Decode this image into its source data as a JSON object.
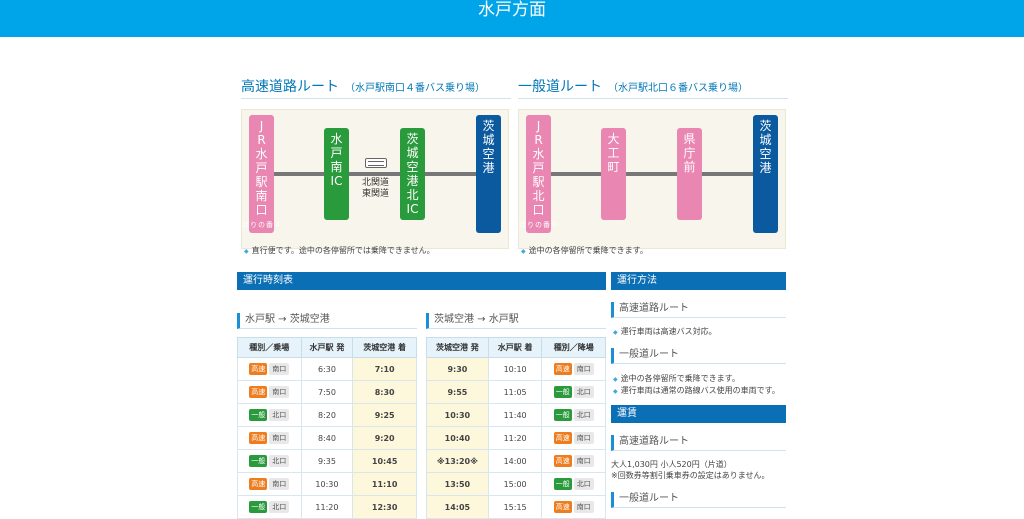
{
  "header": {
    "title": "水戸方面"
  },
  "routes": {
    "expressway": {
      "title": "高速道路ルート",
      "sub": "（水戸駅南口４番バス乗り場）",
      "stops": [
        {
          "lines": [
            "J",
            "R",
            "水",
            "戸",
            "駅",
            "南",
            "口"
          ],
          "tiny": "４番のりば",
          "color": "pink"
        },
        {
          "lines": [
            "水",
            "戸",
            "南",
            "IC"
          ],
          "color": "green"
        },
        {
          "lines": [
            "茨",
            "城",
            "空",
            "港",
            "北",
            "IC"
          ],
          "color": "green"
        },
        {
          "lines": [
            "茨",
            "城",
            "空",
            "港"
          ],
          "color": "navy"
        }
      ],
      "bus_label": "北関道\n東関道",
      "note": "直行便です。途中の各停留所では乗降できません。"
    },
    "general": {
      "title": "一般道ルート",
      "sub": "（水戸駅北口６番バス乗り場）",
      "stops": [
        {
          "lines": [
            "J",
            "R",
            "水",
            "戸",
            "駅",
            "北",
            "口"
          ],
          "tiny": "６番のりば",
          "color": "pink"
        },
        {
          "lines": [
            "大",
            "工",
            "町"
          ],
          "color": "pink"
        },
        {
          "lines": [
            "県",
            "庁",
            "前"
          ],
          "color": "pink"
        },
        {
          "lines": [
            "茨",
            "城",
            "空",
            "港"
          ],
          "color": "navy"
        }
      ],
      "note": "途中の各停留所で乗降できます。"
    }
  },
  "timetable": {
    "bar": "運行時刻表",
    "to_airport": {
      "title": "水戸駅 → 茨城空港",
      "headers": [
        "種別／乗場",
        "水戸駅 発",
        "茨城空港 着"
      ],
      "rows": [
        {
          "type": "高速",
          "gate": "南口",
          "dep": "6:30",
          "arr": "7:10"
        },
        {
          "type": "高速",
          "gate": "南口",
          "dep": "7:50",
          "arr": "8:30"
        },
        {
          "type": "一般",
          "gate": "北口",
          "dep": "8:20",
          "arr": "9:25"
        },
        {
          "type": "高速",
          "gate": "南口",
          "dep": "8:40",
          "arr": "9:20"
        },
        {
          "type": "一般",
          "gate": "北口",
          "dep": "9:35",
          "arr": "10:45"
        },
        {
          "type": "高速",
          "gate": "南口",
          "dep": "10:30",
          "arr": "11:10"
        },
        {
          "type": "一般",
          "gate": "北口",
          "dep": "11:20",
          "arr": "12:30"
        }
      ]
    },
    "to_mito": {
      "title": "茨城空港 → 水戸駅",
      "headers": [
        "茨城空港 発",
        "水戸駅 着",
        "種別／降場"
      ],
      "rows": [
        {
          "dep": "9:30",
          "arr": "10:10",
          "type": "高速",
          "gate": "南口"
        },
        {
          "dep": "9:55",
          "arr": "11:05",
          "type": "一般",
          "gate": "北口"
        },
        {
          "dep": "10:30",
          "arr": "11:40",
          "type": "一般",
          "gate": "北口"
        },
        {
          "dep": "10:40",
          "arr": "11:20",
          "type": "高速",
          "gate": "南口"
        },
        {
          "dep": "※13:20※",
          "arr": "14:00",
          "type": "高速",
          "gate": "南口"
        },
        {
          "dep": "13:50",
          "arr": "15:00",
          "type": "一般",
          "gate": "北口"
        },
        {
          "dep": "14:05",
          "arr": "15:15",
          "type": "高速",
          "gate": "南口"
        }
      ]
    }
  },
  "operation": {
    "bar": "運行方法",
    "express_title": "高速道路ルート",
    "express_notes": [
      "運行車両は高速バス対応。"
    ],
    "general_title": "一般道ルート",
    "general_notes": [
      "途中の各停留所で乗降できます。",
      "運行車両は通常の路線バス使用の車両です。"
    ]
  },
  "fare": {
    "bar": "運賃",
    "express_title": "高速道路ルート",
    "express_text": "大人1,030円 小人520円（片道）",
    "express_note": "※回数券等割引乗車券の設定はありません。",
    "general_title": "一般道ルート"
  }
}
